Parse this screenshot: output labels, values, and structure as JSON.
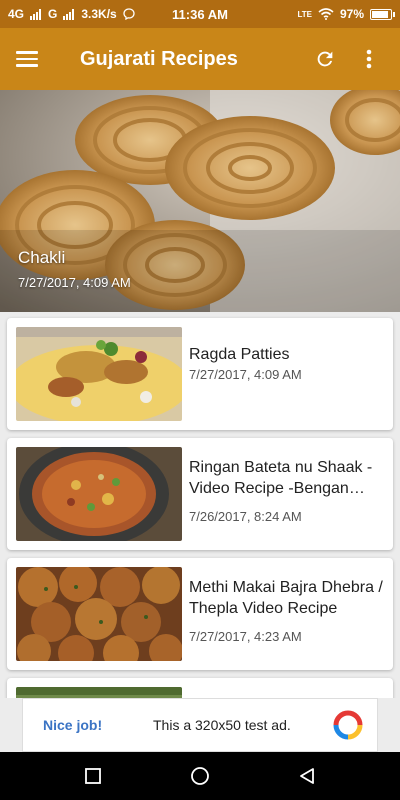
{
  "status_bar": {
    "network": "4G",
    "network2": "G",
    "speed": "3.3K/s",
    "time": "11:36 AM",
    "lte": "LTE",
    "battery_text": "97%",
    "battery_level": 0.97
  },
  "app_bar": {
    "title": "Gujarati Recipes",
    "menu_icon": "hamburger-icon",
    "refresh_icon": "refresh-icon",
    "more_icon": "more-vertical-icon"
  },
  "featured": {
    "title": "Chakli",
    "date": "7/27/2017, 4:09 AM"
  },
  "recipes": [
    {
      "title": "Ragda Patties",
      "date": "7/27/2017, 4:09 AM"
    },
    {
      "title": "Ringan Bateta nu Shaak - Video Recipe  -Bengan Bateta",
      "date": "7/26/2017, 8:24 AM"
    },
    {
      "title": "Methi Makai Bajra Dhebra / Thepla Video Recipe",
      "date": "7/27/2017, 4:23 AM"
    },
    {
      "title": "",
      "date": ""
    }
  ],
  "ad": {
    "label": "Nice job!",
    "text": "This a 320x50 test ad."
  },
  "colors": {
    "status_bar": "#b06c12",
    "app_bar": "#c98618",
    "ad_label": "#3b74c4"
  }
}
